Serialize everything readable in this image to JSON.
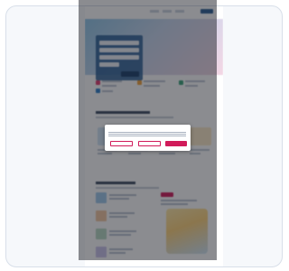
{
  "page": {
    "title": "",
    "colors": {
      "frame_bg": "#f6f8fb",
      "frame_border": "#d8dfe9",
      "brand_blue": "#1f6fb5",
      "accent_pink": "#d11b5a",
      "panel_blue": "#1e548c",
      "overlay": "rgba(24,26,34,0.50)"
    }
  },
  "site": {
    "logo_text": "",
    "hero_headline": "",
    "search_button_label": ""
  },
  "cookie_dialog": {
    "title": "",
    "body_text": "",
    "buttons": [
      {
        "label": "",
        "style": "outline"
      },
      {
        "label": "",
        "style": "outline"
      },
      {
        "label": "",
        "style": "primary"
      }
    ]
  }
}
